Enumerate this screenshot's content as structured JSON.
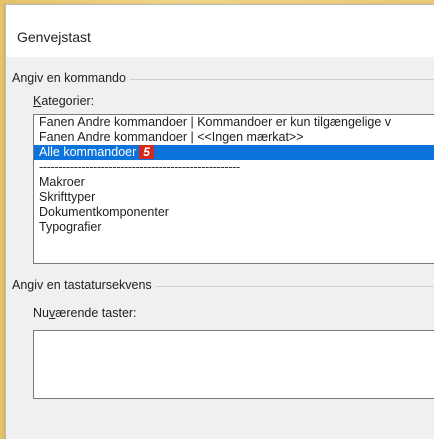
{
  "dialog": {
    "title": "Genvejstast"
  },
  "command_group": {
    "label": "Angiv en kommando",
    "categories_label_accel": "K",
    "categories_label_rest": "ategorier:",
    "categories": [
      {
        "label": "Fanen Andre kommandoer | Kommandoer er kun tilgængelige v",
        "selected": false
      },
      {
        "label": "Fanen Andre kommandoer | <<Ingen mærkat>>",
        "selected": false
      },
      {
        "label": "Alle kommandoer",
        "selected": true,
        "badge": "5"
      },
      {
        "label": "----------------------------------------------------",
        "selected": false,
        "separator": true
      },
      {
        "label": "Makroer",
        "selected": false
      },
      {
        "label": "Skrifttyper",
        "selected": false
      },
      {
        "label": "Dokumentkomponenter",
        "selected": false
      },
      {
        "label": "Typografier",
        "selected": false
      }
    ]
  },
  "keyseq_group": {
    "label": "Angiv en tastatursekvens",
    "current_keys_label_pre": "Nu",
    "current_keys_label_accel": "v",
    "current_keys_label_post": "ærende taster:",
    "current_keys_value": ""
  },
  "colors": {
    "selection": "#0b73d9",
    "badge": "#d4271f"
  }
}
